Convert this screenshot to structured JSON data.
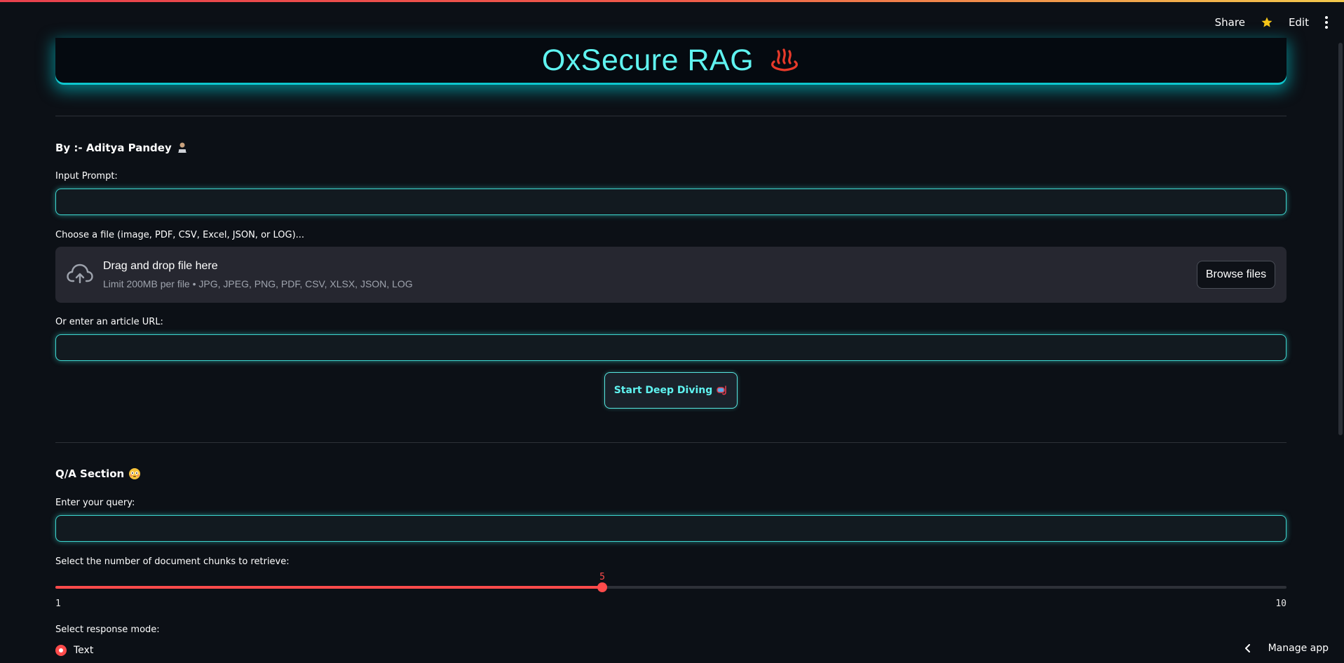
{
  "header": {
    "share_label": "Share",
    "edit_label": "Edit"
  },
  "title": {
    "text": "OxSecure RAG",
    "icon": "hot-springs-icon"
  },
  "author": {
    "text": "By :- Aditya Pandey",
    "icon": "technologist-icon"
  },
  "prompt": {
    "label": "Input Prompt:",
    "value": ""
  },
  "uploader": {
    "label": "Choose a file (image, PDF, CSV, Excel, JSON, or LOG)...",
    "title": "Drag and drop file here",
    "subtitle": "Limit 200MB per file • JPG, JPEG, PNG, PDF, CSV, XLSX, JSON, LOG",
    "browse_label": "Browse files"
  },
  "url": {
    "label": "Or enter an article URL:",
    "value": ""
  },
  "start_button": {
    "label": "Start Deep Diving",
    "icon": "diving-mask-icon"
  },
  "qa": {
    "heading": "Q/A Section",
    "icon": "flushed-face-icon",
    "query_label": "Enter your query:",
    "query_value": ""
  },
  "chunks_slider": {
    "label": "Select the number of document chunks to retrieve:",
    "min": "1",
    "max": "10",
    "value": "5",
    "fraction": 0.4444
  },
  "response_mode": {
    "label": "Select response mode:",
    "selected_option": "Text"
  },
  "footer": {
    "manage_label": "Manage app"
  },
  "colors": {
    "accent_cyan": "#5ff3f0",
    "accent_red": "#ff4b4b",
    "background": "#0c1016"
  }
}
